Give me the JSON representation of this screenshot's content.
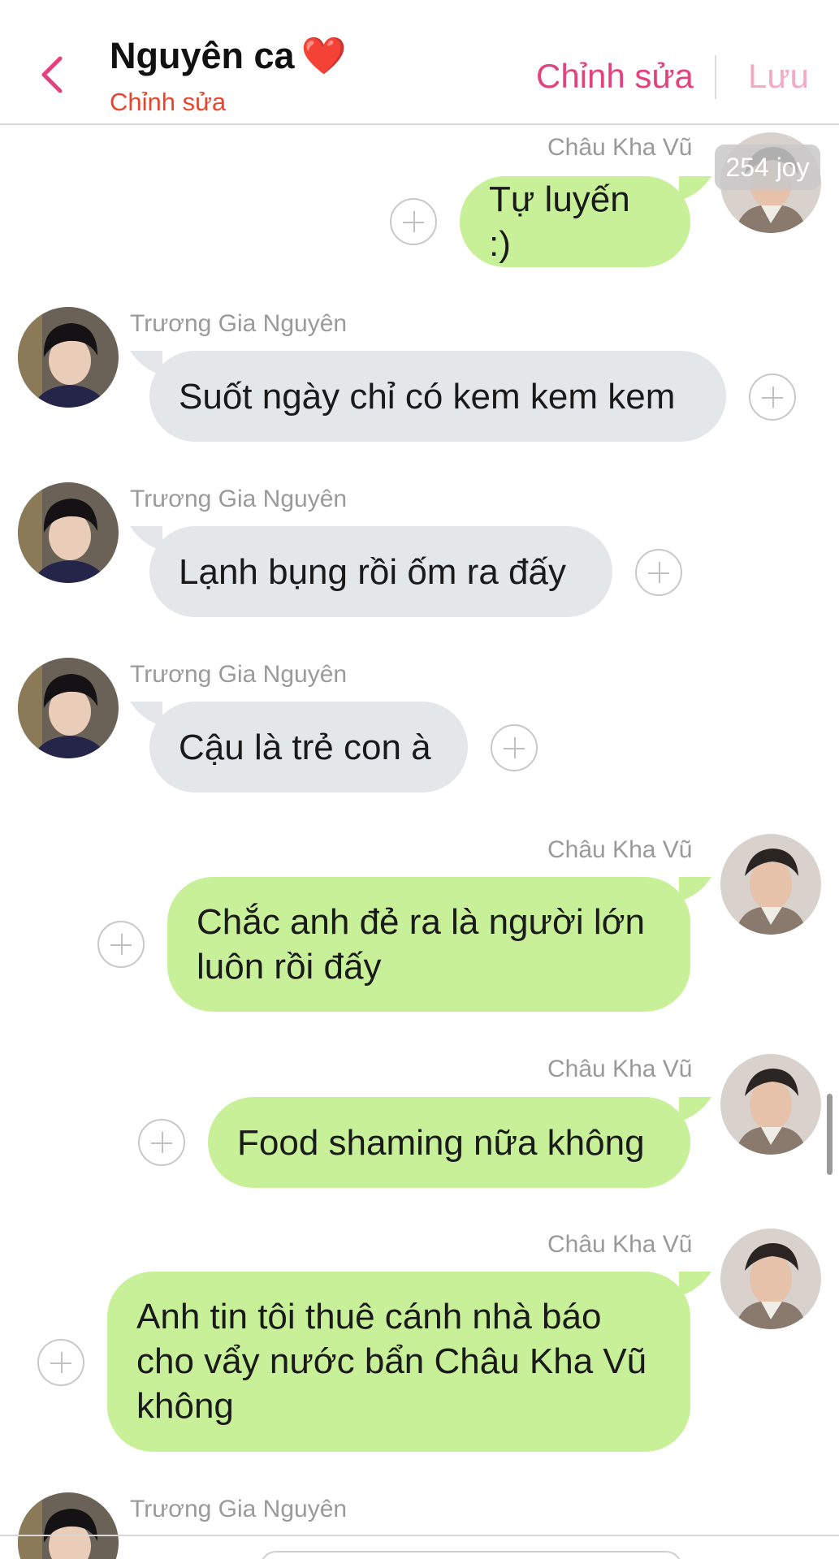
{
  "header": {
    "title": "Nguyên ca",
    "title_emoji": "❤️",
    "subtitle": "Chỉnh sửa",
    "edit_label": "Chỉnh sửa",
    "save_label": "Lưu"
  },
  "badge": "254 joy",
  "messages": [
    {
      "sender": "Châu Kha Vũ",
      "text": "Tự luyến :)"
    },
    {
      "sender": "Trương Gia Nguyên",
      "text": "Suốt ngày chỉ có kem kem kem"
    },
    {
      "sender": "Trương Gia Nguyên",
      "text": "Lạnh bụng rồi ốm ra đấy"
    },
    {
      "sender": "Trương Gia Nguyên",
      "text": "Cậu là trẻ con à"
    },
    {
      "sender": "Châu Kha Vũ",
      "text": "Chắc anh đẻ ra là người lớn luôn rồi đấy"
    },
    {
      "sender": "Châu Kha Vũ",
      "text": "Food shaming nữa không"
    },
    {
      "sender": "Châu Kha Vũ",
      "text": "Anh tin tôi thuê cánh nhà báo cho vẩy nước bẩn Châu Kha Vũ không"
    },
    {
      "sender": "Trương Gia Nguyên",
      "text": ""
    }
  ],
  "colors": {
    "accent": "#e4427e",
    "outgoing_bubble": "#c8f099",
    "incoming_bubble": "#e4e7ea",
    "subtitle": "#e8452e"
  },
  "icons": {
    "back": "chevron-left-icon",
    "add_reaction": "plus-circle-icon"
  }
}
